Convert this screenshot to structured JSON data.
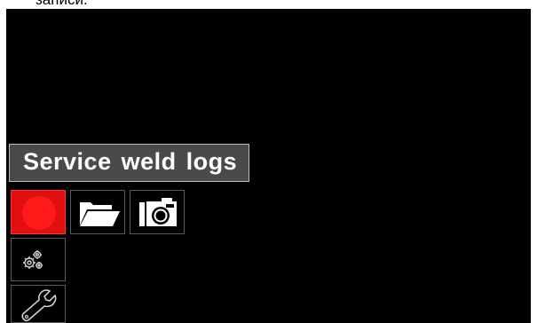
{
  "document": {
    "caption_fragment": "записи."
  },
  "screen": {
    "title": "Service weld logs",
    "colors": {
      "background": "#000000",
      "title_bar": "#4a4a4a",
      "selected_tile": "#e01010",
      "icon": "#ffffff"
    },
    "toolbar": [
      {
        "icon": "record-circle-icon",
        "selected": true
      },
      {
        "icon": "folder-open-icon",
        "selected": false
      },
      {
        "icon": "camera-icon",
        "selected": false
      }
    ],
    "side_menu": [
      {
        "icon": "gears-icon",
        "selected": false
      },
      {
        "icon": "wrench-icon",
        "selected": false
      }
    ]
  }
}
